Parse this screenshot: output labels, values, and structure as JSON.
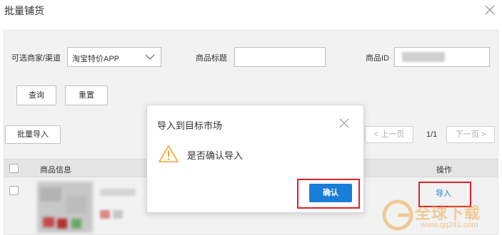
{
  "dialog": {
    "title": "批量铺货"
  },
  "filters": {
    "merchant_label": "可选商家/渠道",
    "merchant_value": "淘宝特价APP",
    "title_label": "商品标题",
    "title_value": "",
    "id_label": "商品ID",
    "id_value": ""
  },
  "actions": {
    "query": "查询",
    "reset": "重置",
    "batch_import": "批量导入"
  },
  "pagination": {
    "prev": "< 上一页",
    "page": "1/1",
    "next": "下一页 >"
  },
  "table": {
    "columns": [
      "商品信息",
      "操作"
    ],
    "rows": [
      {
        "action": "导入"
      }
    ]
  },
  "modal": {
    "title": "导入到目标市场",
    "message": "是否确认导入",
    "confirm": "确认"
  },
  "watermark": {
    "name": "全球下载",
    "url": "www.qq241.com"
  },
  "colors": {
    "primary": "#1a7dd7",
    "highlight": "#e0202a",
    "warning": "#f2a12b"
  }
}
